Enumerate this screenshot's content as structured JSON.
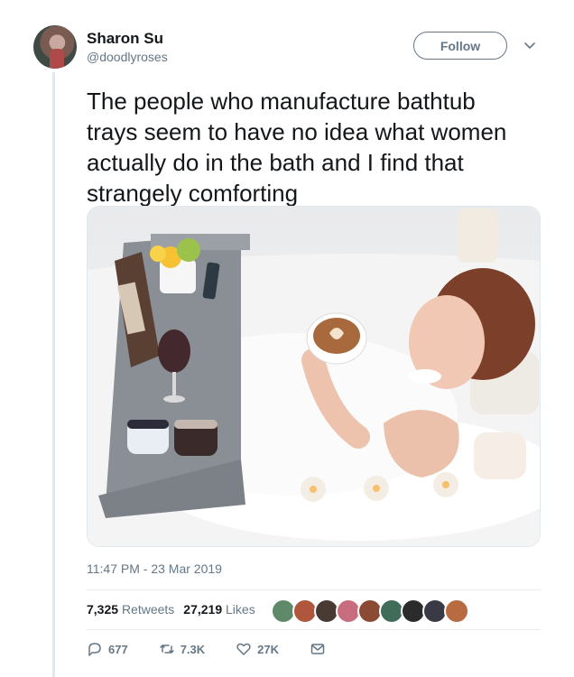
{
  "author": {
    "name": "Sharon Su",
    "handle": "@doodlyroses"
  },
  "follow_button": {
    "label": "Follow"
  },
  "tweet": {
    "lines": [
      "The people who manufacture bathtub",
      "trays seem to have no idea what women",
      "actually do in the bath and I find that",
      "strangely comforting"
    ],
    "timestamp": "11:47 PM - 23 Mar 2019"
  },
  "stats": {
    "retweets_count": "7,325",
    "retweets_label": "Retweets",
    "likes_count": "27,219",
    "likes_label": "Likes"
  },
  "actions": {
    "replies": "677",
    "retweets": "7.3K",
    "likes": "27K"
  },
  "icons": {
    "menu": "chevron-down-icon",
    "reply": "reply-icon",
    "retweet": "retweet-icon",
    "like": "heart-icon",
    "dm": "envelope-icon"
  },
  "colors": {
    "text": "#14171a",
    "secondary": "#657786",
    "border": "#e1e8ed"
  }
}
